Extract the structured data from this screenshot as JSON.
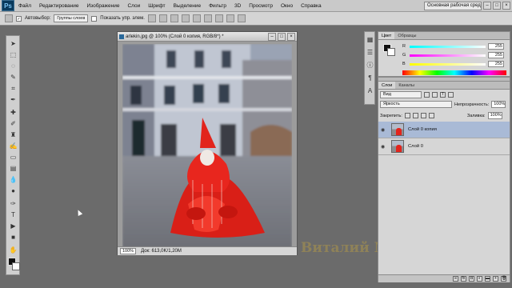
{
  "menubar": {
    "logo": "Ps",
    "items": [
      "Файл",
      "Редактирование",
      "Изображение",
      "Слои",
      "Шрифт",
      "Выделение",
      "Фильтр",
      "3D",
      "Просмотр",
      "Окно",
      "Справка"
    ],
    "workspace": "Основная рабочая среда"
  },
  "options": {
    "autoselect_label": "Автовыбор:",
    "autoselect_value": "Группы слоев",
    "show_controls_label": "Показать упр. элем."
  },
  "document": {
    "title": "arlekin.jpg @ 100% (Слой 0 копия, RGB/8*) *",
    "zoom": "100%",
    "doc_info": "Док: 613,0K/1,20M"
  },
  "color_panel": {
    "tabs": [
      "Цвет",
      "Образцы"
    ],
    "channels": [
      {
        "label": "R",
        "value": "255"
      },
      {
        "label": "G",
        "value": "255"
      },
      {
        "label": "B",
        "value": "255"
      }
    ]
  },
  "layers_panel": {
    "tabs": [
      "Слои",
      "Каналы"
    ],
    "kind_filter": "Вид",
    "blend_mode": "Яркость",
    "opacity_label": "Непрозрачность:",
    "opacity_value": "100%",
    "lock_label": "Закрепить:",
    "fill_label": "Заливка:",
    "fill_value": "100%",
    "layers": [
      {
        "name": "Слой 0 копия",
        "selected": true
      },
      {
        "name": "Слой 0",
        "selected": false
      }
    ]
  },
  "watermark": "Виталий Мельчинский",
  "colors": {
    "accent": "#a9bad6",
    "costume": "#e3241c"
  }
}
